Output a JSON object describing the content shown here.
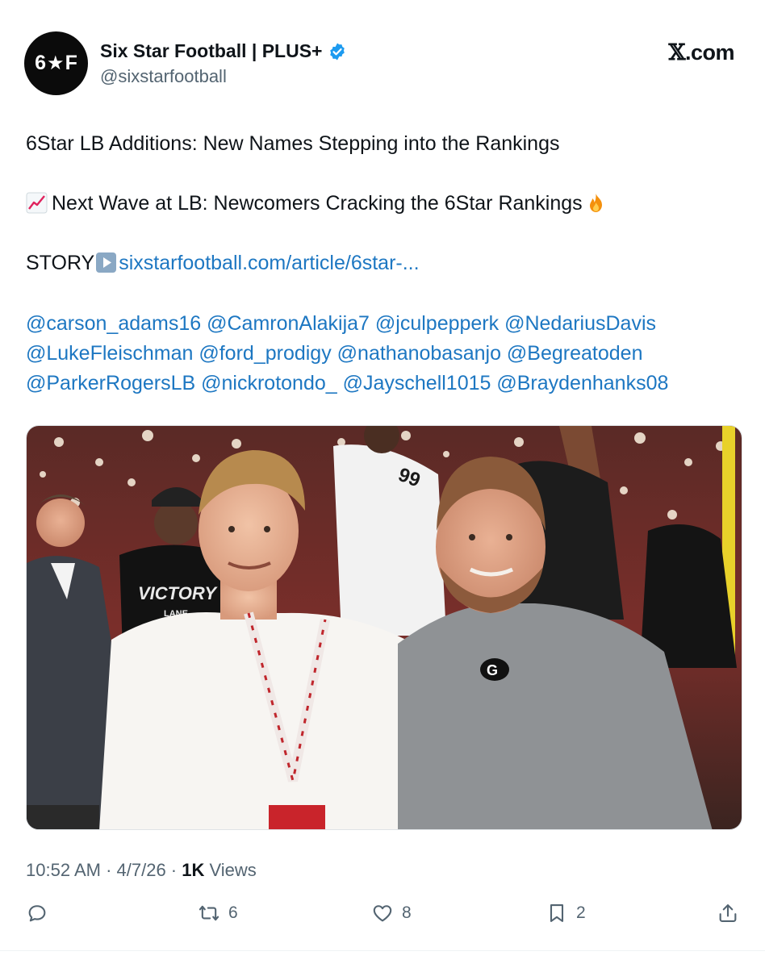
{
  "profile": {
    "avatar_text_left": "6",
    "avatar_text_right": "F",
    "display_name": "Six Star Football | PLUS+",
    "handle": "@sixstarfootball",
    "verified_color": "#1d9bf0"
  },
  "brand": {
    "x": "𝕏",
    "suffix": ".com"
  },
  "post": {
    "line1": "6Star LB Additions: New Names Stepping into the Rankings",
    "line2": "Next Wave at LB: Newcomers Cracking the 6Star Rankings",
    "story_label": "STORY",
    "story_link": "sixstarfootball.com/article/6star-...",
    "mentions_row1": "@carson_adams16 @CamronAlakija7 @jculpepperk @NedariusDavis",
    "mentions_row2": "@LukeFleischman  @ford_prodigy @nathanobasanjo @Begreatoden",
    "mentions_row3": "@ParkerRogersLB @nickrotondo_ @Jayschell1015 @Braydenhanks08"
  },
  "media": {
    "jersey_number": "99",
    "shirt_text": "VICTORY",
    "shirt_sub": "LANE",
    "logo_letter": "G"
  },
  "meta": {
    "time": "10:52 AM",
    "separator": " · ",
    "date": "4/7/26",
    "views_count": "1K",
    "views_label": " Views"
  },
  "actions": {
    "reply_count": "",
    "repost_count": "6",
    "like_count": "8",
    "bookmark_count": "2"
  },
  "colors": {
    "link": "#1d77c2",
    "muted": "#536471",
    "text": "#0f1419"
  }
}
